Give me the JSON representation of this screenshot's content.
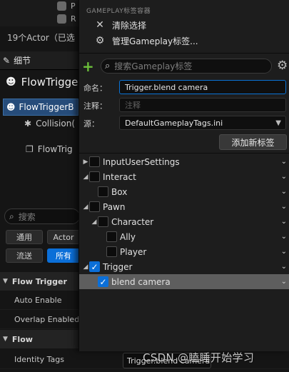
{
  "background": {
    "top_rows": [
      "P",
      "R"
    ],
    "actor_count": "19个Actor（已选",
    "details_tab": "细节",
    "actor_title": "FlowTrigger",
    "component_selected": "FlowTriggerB",
    "component_collision": "Collision(",
    "component_flowtrig": "FlowTrig",
    "search_placeholder": "搜索",
    "filters": {
      "common": "通用",
      "actor": "Actor",
      "streaming": "流送",
      "all": "所有"
    },
    "sections": [
      {
        "category": "Flow Trigger",
        "props": [
          "Auto Enable",
          "Overlap Enabled"
        ]
      },
      {
        "category": "Flow",
        "props": [
          "Identity Tags"
        ]
      }
    ],
    "identity_tags_value": "Trigger.blend camera"
  },
  "popup": {
    "header": "GAMEPLAY标签容器",
    "menu": {
      "clear": "清除选择",
      "manage": "管理Gameplay标签..."
    },
    "search_placeholder": "搜索Gameplay标签",
    "form": {
      "name_label": "命名：",
      "name_value": "Trigger.blend camera",
      "comment_label": "注释：",
      "comment_placeholder": "注释",
      "source_label": "源：",
      "source_value": "DefaultGameplayTags.ini",
      "add_button": "添加新标签"
    },
    "tree": [
      {
        "label": "InputUserSettings",
        "depth": 0,
        "expander": "▶",
        "checked": false,
        "selected": false
      },
      {
        "label": "Interact",
        "depth": 0,
        "expander": "◢",
        "checked": false,
        "selected": false
      },
      {
        "label": "Box",
        "depth": 1,
        "expander": "",
        "checked": false,
        "selected": false
      },
      {
        "label": "Pawn",
        "depth": 0,
        "expander": "◢",
        "checked": false,
        "selected": false
      },
      {
        "label": "Character",
        "depth": 1,
        "expander": "◢",
        "checked": false,
        "selected": false
      },
      {
        "label": "Ally",
        "depth": 2,
        "expander": "",
        "checked": false,
        "selected": false
      },
      {
        "label": "Player",
        "depth": 2,
        "expander": "",
        "checked": false,
        "selected": false
      },
      {
        "label": "Trigger",
        "depth": 0,
        "expander": "◢",
        "checked": true,
        "selected": false
      },
      {
        "label": "blend camera",
        "depth": 1,
        "expander": "",
        "checked": true,
        "selected": true
      }
    ]
  },
  "watermark": "CSDN @瞌睡开始学习",
  "colors": {
    "accent": "#0b6fd8",
    "add_green": "#6bbf3a",
    "selected_row": "#5e5e5e"
  }
}
